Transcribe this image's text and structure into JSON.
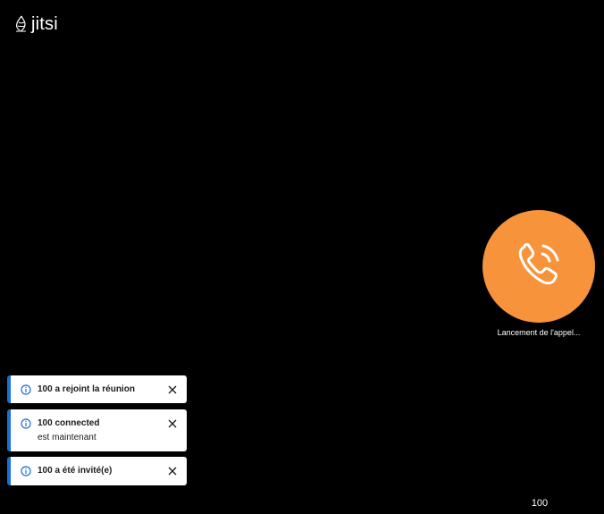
{
  "brand": {
    "name": "jitsi"
  },
  "call": {
    "status": "Lancement de l'appel...",
    "icon": "phone-ringing-icon",
    "accent": "#f7933b"
  },
  "participant": {
    "name": "100"
  },
  "notifications": [
    {
      "title": "100 a rejoint la réunion",
      "description": ""
    },
    {
      "title": "100 connected",
      "description": "est maintenant"
    },
    {
      "title": "100 a été invité(e)",
      "description": ""
    }
  ],
  "colors": {
    "background": "#000000",
    "toast_accent": "#1a6fd4",
    "toast_bg": "#ffffff"
  }
}
